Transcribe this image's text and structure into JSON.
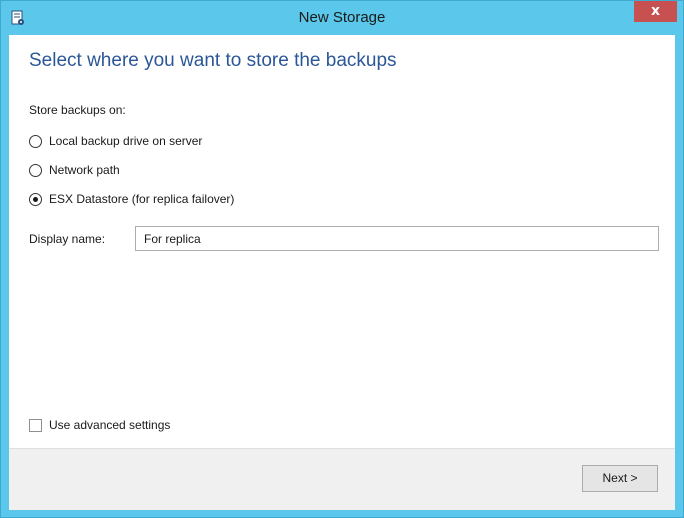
{
  "window": {
    "title": "New Storage",
    "close_label": "x",
    "app_icon": "storage-wizard-icon",
    "titlebar_color": "#5bc7ea"
  },
  "page": {
    "heading": "Select where you want to store the backups",
    "heading_color": "#2b5797"
  },
  "store_on": {
    "label": "Store backups on:",
    "options": [
      {
        "label": "Local backup drive on server",
        "checked": false
      },
      {
        "label": "Network path",
        "checked": false
      },
      {
        "label": "ESX Datastore (for replica failover)",
        "checked": true
      }
    ]
  },
  "display_name": {
    "label": "Display name:",
    "value": "For replica"
  },
  "advanced": {
    "label": "Use advanced settings",
    "checked": false
  },
  "footer": {
    "next_label": "Next >"
  }
}
